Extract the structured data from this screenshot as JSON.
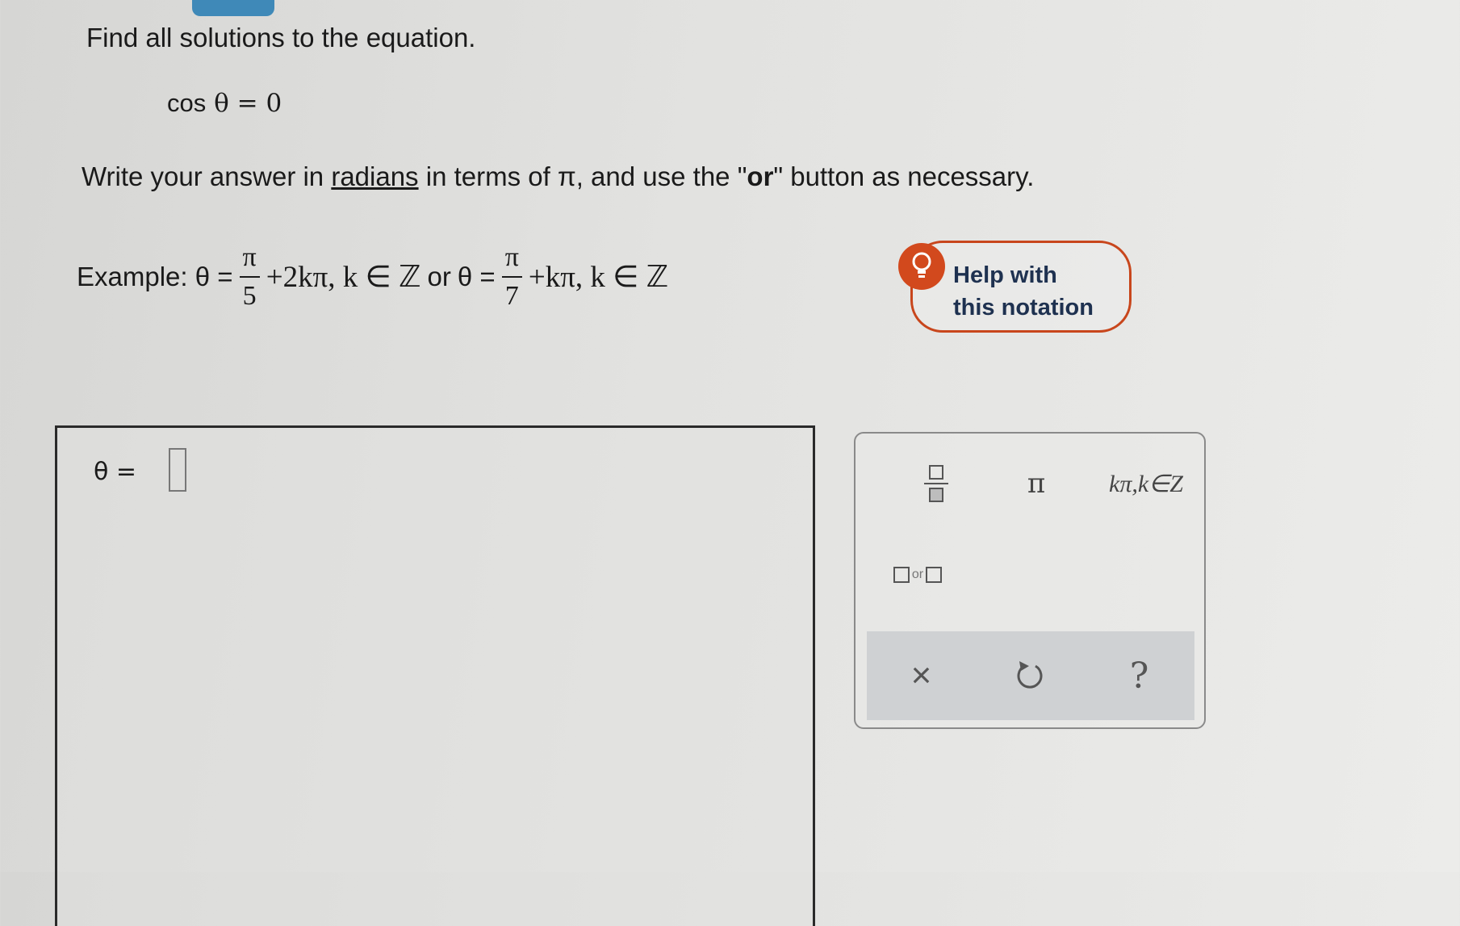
{
  "question": {
    "prompt": "Find all solutions to the equation.",
    "equation": {
      "fn": "cos",
      "var": "θ",
      "rest": " = 0"
    },
    "instructions": {
      "part1": "Write your answer in ",
      "link": "radians",
      "part2": " in terms of π, and use the \"",
      "bold": "or",
      "part3": "\" button as necessary."
    },
    "example": {
      "label": "Example: θ =",
      "frac1": {
        "num": "π",
        "den": "5"
      },
      "term1": "+2kπ, k ∈ ℤ",
      "or": "or",
      "theta2": "θ =",
      "frac2": {
        "num": "π",
        "den": "7"
      },
      "term2": "+kπ, k ∈ ℤ"
    }
  },
  "help": {
    "line1": "Help with",
    "line2": "this notation",
    "icon": "lightbulb-icon",
    "color": "#d2491d"
  },
  "answer": {
    "label": "θ =",
    "value": ""
  },
  "palette": {
    "pi": "π",
    "kpi": "kπ,k∈Z",
    "or_text": "or",
    "clear": "×",
    "help": "?",
    "icons": [
      "fraction-icon",
      "or-icon",
      "undo-icon"
    ]
  }
}
